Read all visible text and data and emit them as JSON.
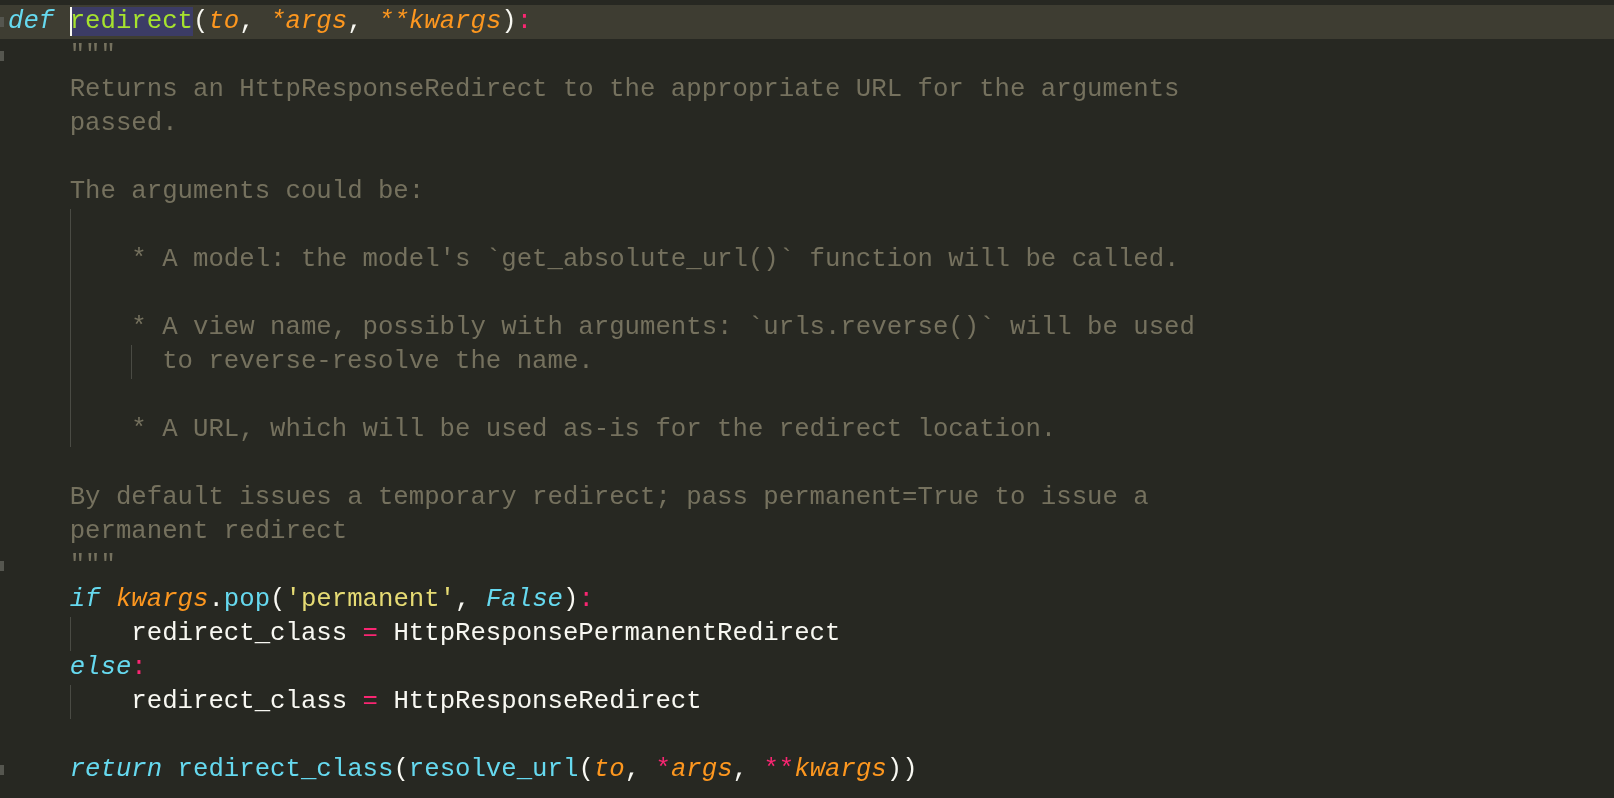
{
  "editor": {
    "lines": [
      {
        "current": true,
        "gutter_mark": true,
        "tokens": [
          {
            "text": "def ",
            "kind": "keyword"
          },
          {
            "text": "redirect",
            "kind": "function_cursor"
          },
          {
            "text": "(",
            "kind": "plain"
          },
          {
            "text": "to",
            "kind": "param"
          },
          {
            "text": ", ",
            "kind": "plain"
          },
          {
            "text": "*args",
            "kind": "param"
          },
          {
            "text": ", ",
            "kind": "plain"
          },
          {
            "text": "**kwargs",
            "kind": "param"
          },
          {
            "text": ")",
            "kind": "plain"
          },
          {
            "text": ":",
            "kind": "operator"
          }
        ],
        "children": [
          {
            "current": false,
            "gutter_mark": true,
            "tokens": [
              {
                "text": "\"\"\"",
                "kind": "comment"
              }
            ]
          },
          {
            "current": false,
            "gutter_mark": false,
            "tokens": [
              {
                "text": "Returns an HttpResponseRedirect to the appropriate URL for the arguments",
                "kind": "comment"
              }
            ]
          },
          {
            "current": false,
            "gutter_mark": false,
            "tokens": [
              {
                "text": "passed.",
                "kind": "comment"
              }
            ]
          },
          {
            "current": false,
            "gutter_mark": false
          },
          {
            "current": false,
            "gutter_mark": false,
            "tokens": [
              {
                "text": "The arguments could be:",
                "kind": "comment"
              }
            ],
            "children": [
              {
                "current": false,
                "gutter_mark": false
              },
              {
                "current": false,
                "gutter_mark": false,
                "tokens": [
                  {
                    "text": "* A model: the model's `get_absolute_url()` function will be called.",
                    "kind": "comment"
                  }
                ]
              },
              {
                "current": false,
                "gutter_mark": false
              },
              {
                "current": false,
                "gutter_mark": false,
                "tokens": [
                  {
                    "text": "* A view name, possibly with arguments: `urls.reverse()` will be used",
                    "kind": "comment"
                  }
                ],
                "children": [
                  {
                    "kind": "continuation",
                    "current": false,
                    "gutter_mark": false,
                    "tokens": [
                      {
                        "text": "to reverse-resolve the name.",
                        "kind": "comment"
                      }
                    ]
                  }
                ]
              },
              {
                "current": false,
                "gutter_mark": false
              },
              {
                "current": false,
                "gutter_mark": false,
                "tokens": [
                  {
                    "text": "* A URL, which will be used as-is for the redirect location.",
                    "kind": "comment"
                  }
                ]
              }
            ]
          },
          {
            "current": false,
            "gutter_mark": false
          },
          {
            "current": false,
            "gutter_mark": false,
            "tokens": [
              {
                "text": "By default issues a temporary redirect; pass permanent=True to issue a",
                "kind": "comment"
              }
            ]
          },
          {
            "current": false,
            "gutter_mark": false,
            "tokens": [
              {
                "text": "permanent redirect",
                "kind": "comment"
              }
            ]
          },
          {
            "current": false,
            "gutter_mark": true,
            "tokens": [
              {
                "text": "\"\"\"",
                "kind": "comment"
              }
            ]
          },
          {
            "current": false,
            "gutter_mark": false,
            "tokens": [
              {
                "text": "if ",
                "kind": "keyword"
              },
              {
                "text": "kwargs",
                "kind": "param"
              },
              {
                "text": ".",
                "kind": "plain"
              },
              {
                "text": "pop",
                "kind": "call"
              },
              {
                "text": "(",
                "kind": "plain"
              },
              {
                "text": "'permanent'",
                "kind": "string"
              },
              {
                "text": ", ",
                "kind": "plain"
              },
              {
                "text": "False",
                "kind": "constant"
              },
              {
                "text": ")",
                "kind": "plain"
              },
              {
                "text": ":",
                "kind": "operator"
              }
            ],
            "children": [
              {
                "current": false,
                "gutter_mark": false,
                "tokens": [
                  {
                    "text": "redirect_class ",
                    "kind": "plain"
                  },
                  {
                    "text": "=",
                    "kind": "operator"
                  },
                  {
                    "text": " HttpResponsePermanentRedirect",
                    "kind": "plain"
                  }
                ]
              }
            ]
          },
          {
            "current": false,
            "gutter_mark": false,
            "tokens": [
              {
                "text": "else",
                "kind": "keyword"
              },
              {
                "text": ":",
                "kind": "operator"
              }
            ],
            "children": [
              {
                "current": false,
                "gutter_mark": false,
                "tokens": [
                  {
                    "text": "redirect_class ",
                    "kind": "plain"
                  },
                  {
                    "text": "=",
                    "kind": "operator"
                  },
                  {
                    "text": " HttpResponseRedirect",
                    "kind": "plain"
                  }
                ]
              }
            ]
          },
          {
            "current": false,
            "gutter_mark": false
          },
          {
            "current": false,
            "gutter_mark": true,
            "tokens": [
              {
                "text": "return ",
                "kind": "keyword"
              },
              {
                "text": "redirect_class",
                "kind": "call"
              },
              {
                "text": "(",
                "kind": "plain"
              },
              {
                "text": "resolve_url",
                "kind": "call"
              },
              {
                "text": "(",
                "kind": "plain"
              },
              {
                "text": "to",
                "kind": "param"
              },
              {
                "text": ", ",
                "kind": "plain"
              },
              {
                "text": "*",
                "kind": "operator"
              },
              {
                "text": "args",
                "kind": "param"
              },
              {
                "text": ", ",
                "kind": "plain"
              },
              {
                "text": "**",
                "kind": "operator"
              },
              {
                "text": "kwargs",
                "kind": "param"
              },
              {
                "text": "))",
                "kind": "plain"
              }
            ]
          }
        ]
      }
    ]
  }
}
